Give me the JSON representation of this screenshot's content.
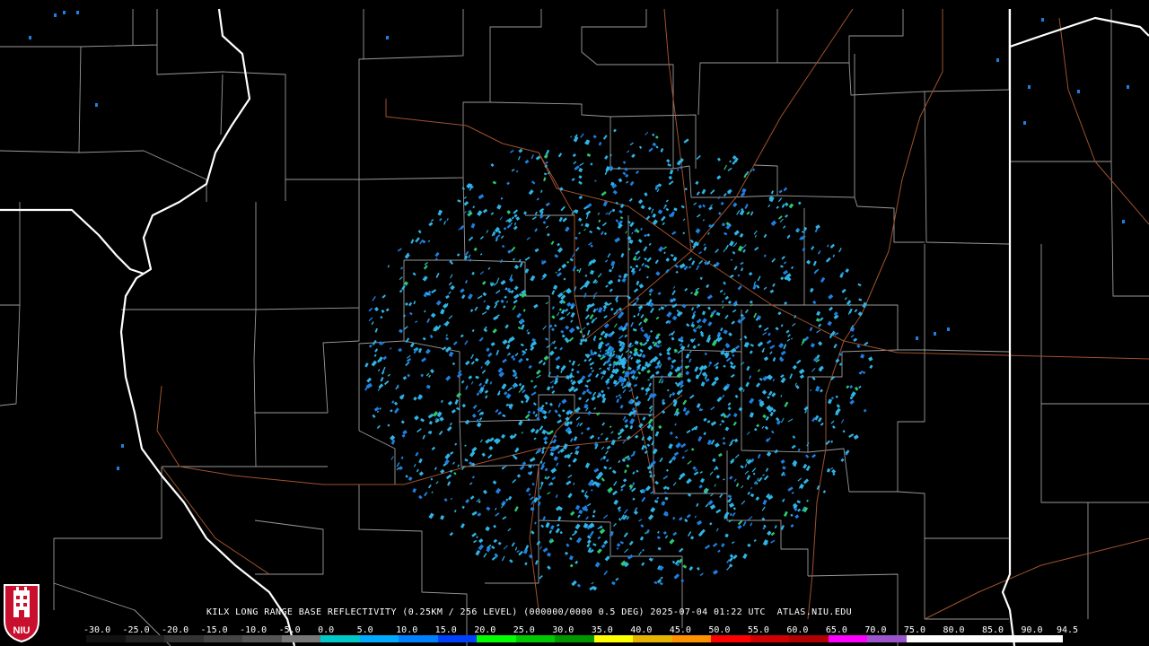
{
  "header": {
    "caption": "KILX LONG RANGE BASE REFLECTIVITY (0.25KM / 256 LEVEL) (000000/0000 0.5 DEG) 2025-07-04 01:22 UTC  ATLAS.NIU.EDU"
  },
  "logo": {
    "text": "NIU",
    "icon": "niu-tower-shield-icon"
  },
  "scale": {
    "labels": [
      "-30.0",
      "-25.0",
      "-20.0",
      "-15.0",
      "-10.0",
      "-5.0",
      "0.0",
      "5.0",
      "10.0",
      "15.0",
      "20.0",
      "25.0",
      "30.0",
      "35.0",
      "40.0",
      "45.0",
      "50.0",
      "55.0",
      "60.0",
      "65.0",
      "70.0",
      "75.0",
      "80.0",
      "85.0",
      "90.0",
      "94.5"
    ],
    "colors": [
      "#111111",
      "#222222",
      "#333333",
      "#444444",
      "#555555",
      "#777777",
      "#00c8c8",
      "#00aaff",
      "#0080ff",
      "#0040ff",
      "#00ff00",
      "#00c800",
      "#009600",
      "#ffff00",
      "#e6b400",
      "#ff9000",
      "#ff0000",
      "#d00000",
      "#b00000",
      "#ff00ff",
      "#9955c9",
      "#ffffff",
      "#ffffff",
      "#ffffff",
      "#ffffff"
    ]
  },
  "colors": {
    "state_line": "#ffffff",
    "county_line": "#9a9a9a",
    "road_line": "#a0522d",
    "echo_light": "#2fb4e6",
    "echo_dark": "#1f7fe0",
    "echo_green": "#2ec86e"
  }
}
